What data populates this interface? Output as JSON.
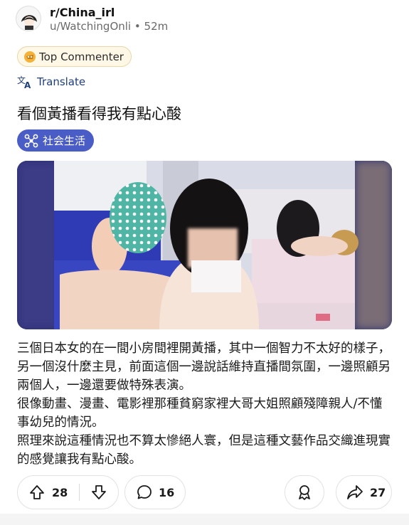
{
  "post": {
    "subreddit": "r/China_irl",
    "author": "u/WatchingOnli",
    "separator": "•",
    "age": "52m",
    "flair": "Top Commenter",
    "translate_label": "Translate",
    "title": "看個黃播看得我有點心酸",
    "tag": "社会生活",
    "body": [
      "三個日本女的在一間小房間裡開黃播，其中一個智力不太好的樣子，另一個沒什麼主見，前面這個一邊說話維持直播間氛圍，一邊照顧另兩個人，一邊還要做特殊表演。",
      "很像動畫、漫畫、電影裡那種貧窮家裡大哥大姐照顧殘障親人/不懂事幼兒的情況。",
      "照理來說這種情況也不算太慘絕人寰，但是這種文藝作品交織進現實的感覺讓我有點心酸。"
    ]
  },
  "actions": {
    "upvotes": "28",
    "comments": "16",
    "shares": "27"
  },
  "colors": {
    "tag_bg": "#4a5cc5",
    "translate": "#1f3f7a",
    "flair_bg": "#fff8e6"
  }
}
